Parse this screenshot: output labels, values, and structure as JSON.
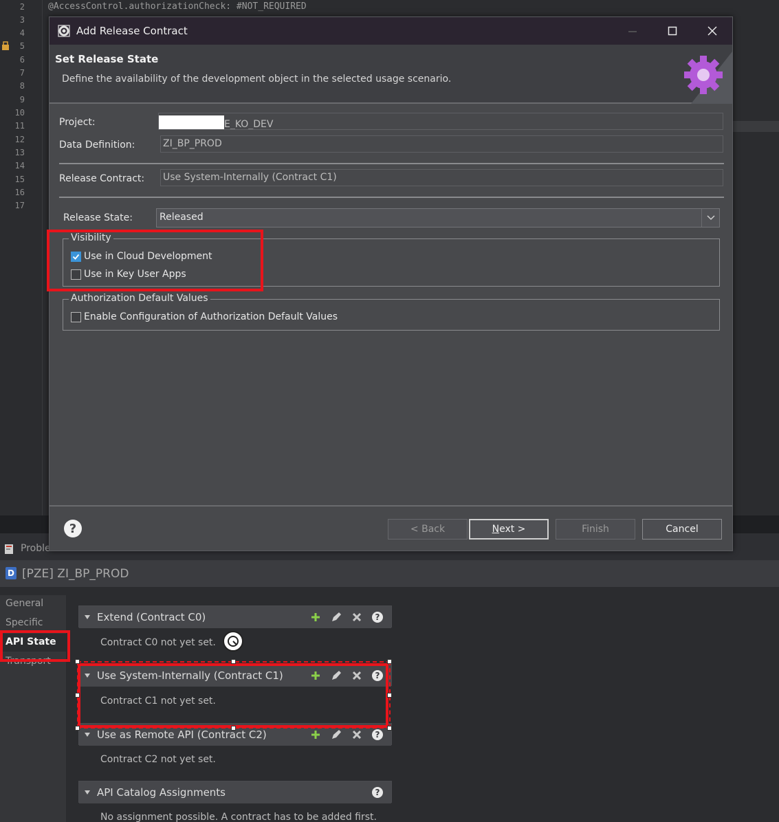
{
  "editor": {
    "line_numbers": [
      "2",
      "3",
      "4",
      "5",
      "6",
      "7",
      "8",
      "9",
      "10",
      "11",
      "12",
      "13",
      "14",
      "15",
      "16",
      "17"
    ],
    "code_line": "@AccessControl.authorizationCheck: #NOT_REQUIRED"
  },
  "dialog": {
    "title": "Add Release Contract",
    "header_title": "Set Release State",
    "header_desc": "Define the availability of the development object in the selected usage scenario.",
    "project_label": "Project:",
    "project_value": "E_KO_DEV",
    "data_def_label": "Data Definition:",
    "data_def_value": "ZI_BP_PROD",
    "release_contract_label": "Release Contract:",
    "release_contract_value": "Use System-Internally (Contract C1)",
    "release_state_label": "Release State:",
    "release_state_value": "Released",
    "visibility_legend": "Visibility",
    "use_cloud_dev": "Use in Cloud Development",
    "use_key_user": "Use in Key User Apps",
    "auth_legend": "Authorization Default Values",
    "enable_auth": "Enable Configuration of Authorization Default Values",
    "help": "?",
    "back_label": "< Back",
    "next_letter": "N",
    "next_rest": "ext >",
    "finish_label": "Finish",
    "cancel_label": "Cancel"
  },
  "panel": {
    "tab_problems": "Proble",
    "object_badge": "D",
    "object_title": "[PZE] ZI_BP_PROD",
    "nav": [
      "General",
      "Specific",
      "API State",
      "Transport"
    ],
    "sections": {
      "c0_title": "Extend (Contract C0)",
      "c0_body": "Contract C0 not yet set.",
      "c1_title": "Use System-Internally (Contract C1)",
      "c1_body": "Contract C1 not yet set.",
      "c2_title": "Use as Remote API (Contract C2)",
      "c2_body": "Contract C2 not yet set.",
      "catalog_title": "API Catalog Assignments",
      "catalog_body": "No assignment possible. A contract has to be added first."
    }
  },
  "colors": {
    "annotation_red": "#e8141b",
    "checkbox_blue": "#3b94d9",
    "gear_purple": "#b35ad8",
    "add_green": "#8bd04a"
  }
}
